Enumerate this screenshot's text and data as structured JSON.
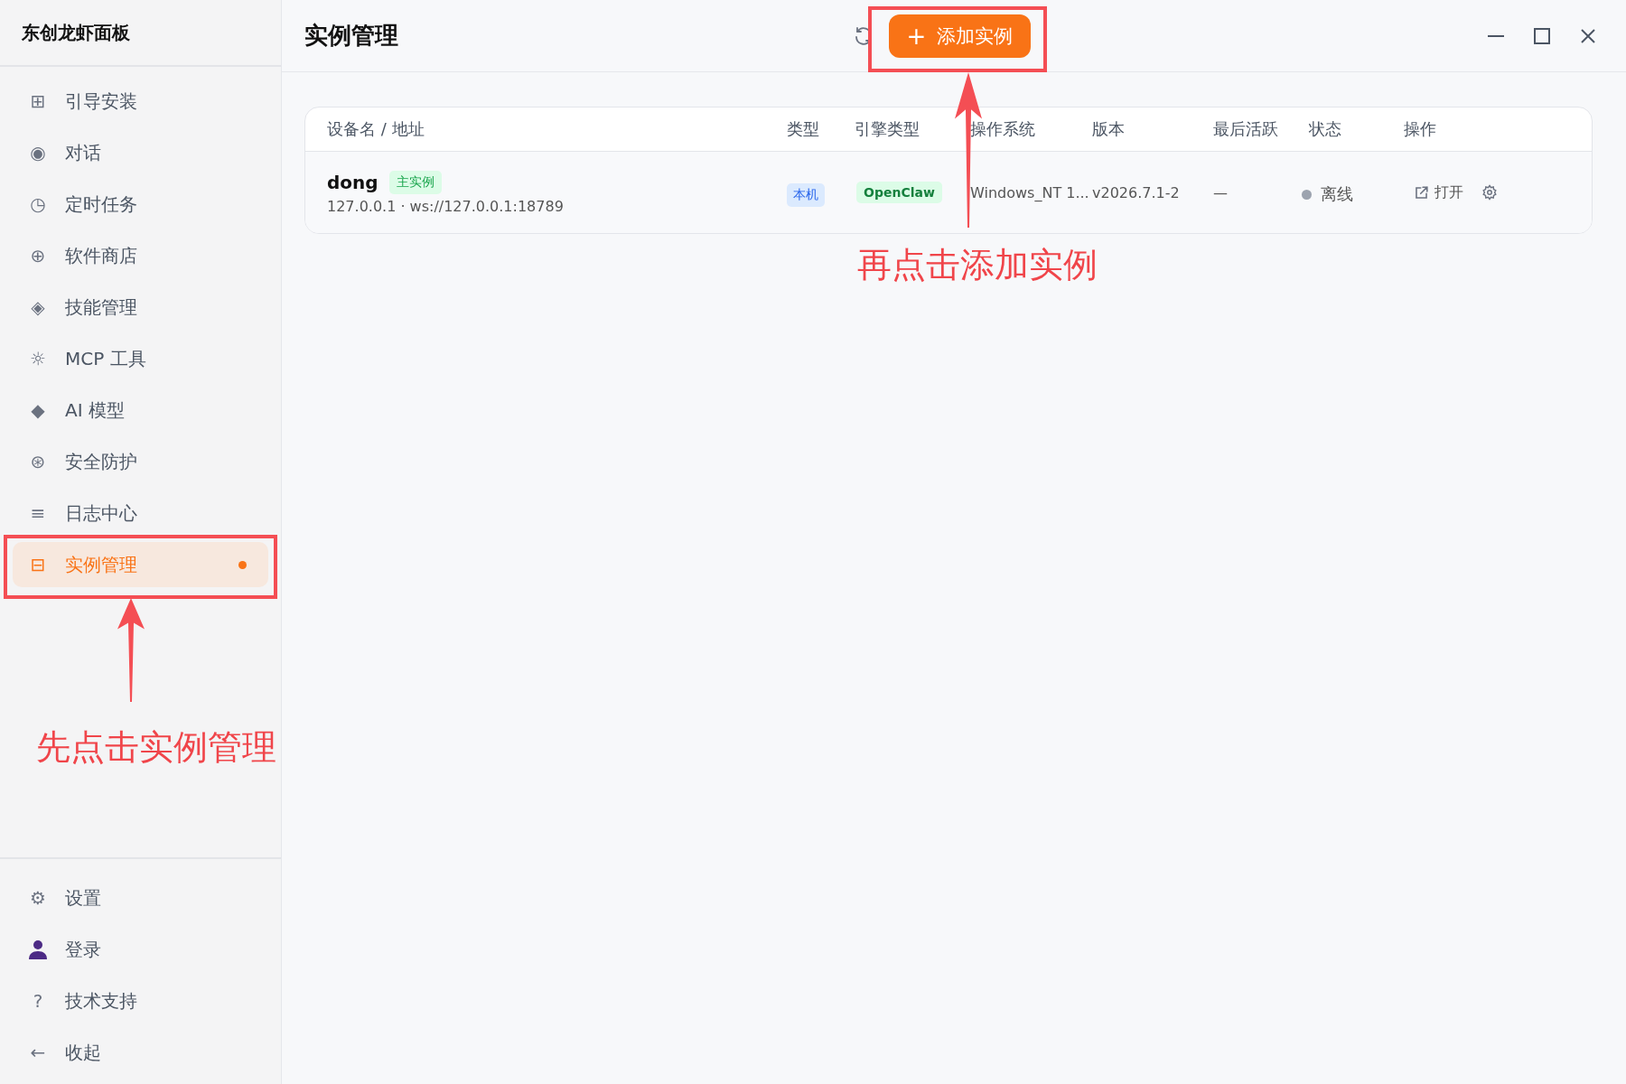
{
  "app": {
    "title": "东创龙虾面板"
  },
  "sidebar": {
    "items": [
      {
        "icon": "⊞",
        "label": "引导安装",
        "selected": false,
        "notify": false
      },
      {
        "icon": "◉",
        "label": "对话",
        "selected": false,
        "notify": false
      },
      {
        "icon": "◷",
        "label": "定时任务",
        "selected": false,
        "notify": false
      },
      {
        "icon": "⊕",
        "label": "软件商店",
        "selected": false,
        "notify": false
      },
      {
        "icon": "◈",
        "label": "技能管理",
        "selected": false,
        "notify": false
      },
      {
        "icon": "☼",
        "label": "MCP 工具",
        "selected": false,
        "notify": false
      },
      {
        "icon": "◆",
        "label": "AI 模型",
        "selected": false,
        "notify": false
      },
      {
        "icon": "⊛",
        "label": "安全防护",
        "selected": false,
        "notify": false
      },
      {
        "icon": "≡",
        "label": "日志中心",
        "selected": false,
        "notify": false
      },
      {
        "icon": "⊟",
        "label": "实例管理",
        "selected": true,
        "notify": true
      }
    ],
    "footer_items": [
      {
        "kind": "glyph",
        "icon": "⚙",
        "label": "设置"
      },
      {
        "kind": "user",
        "label": "登录"
      },
      {
        "kind": "glyph",
        "icon": "?",
        "label": "技术支持"
      },
      {
        "kind": "glyph",
        "icon": "←",
        "label": "收起"
      }
    ]
  },
  "header": {
    "title": "实例管理",
    "add_button": {
      "icon": "+",
      "label": "添加实例"
    }
  },
  "table": {
    "columns": [
      "设备名 / 地址",
      "类型",
      "引擎类型",
      "操作系统",
      "版本",
      "最后活跃",
      "状态",
      "操作"
    ],
    "rows": [
      {
        "name": "dong",
        "tag": "主实例",
        "address": "127.0.0.1 · ws://127.0.0.1:18789",
        "type": "本机",
        "engine": "OpenClaw",
        "os": "Windows_NT 1...",
        "version": "v2026.7.1-2",
        "last_active": "—",
        "status": "离线",
        "online": false,
        "open_label": "打开"
      }
    ]
  },
  "annotations": [
    {
      "kind": "sidebar",
      "text": "先点击实例管理"
    },
    {
      "kind": "add",
      "text": "再点击添加实例"
    }
  ]
}
